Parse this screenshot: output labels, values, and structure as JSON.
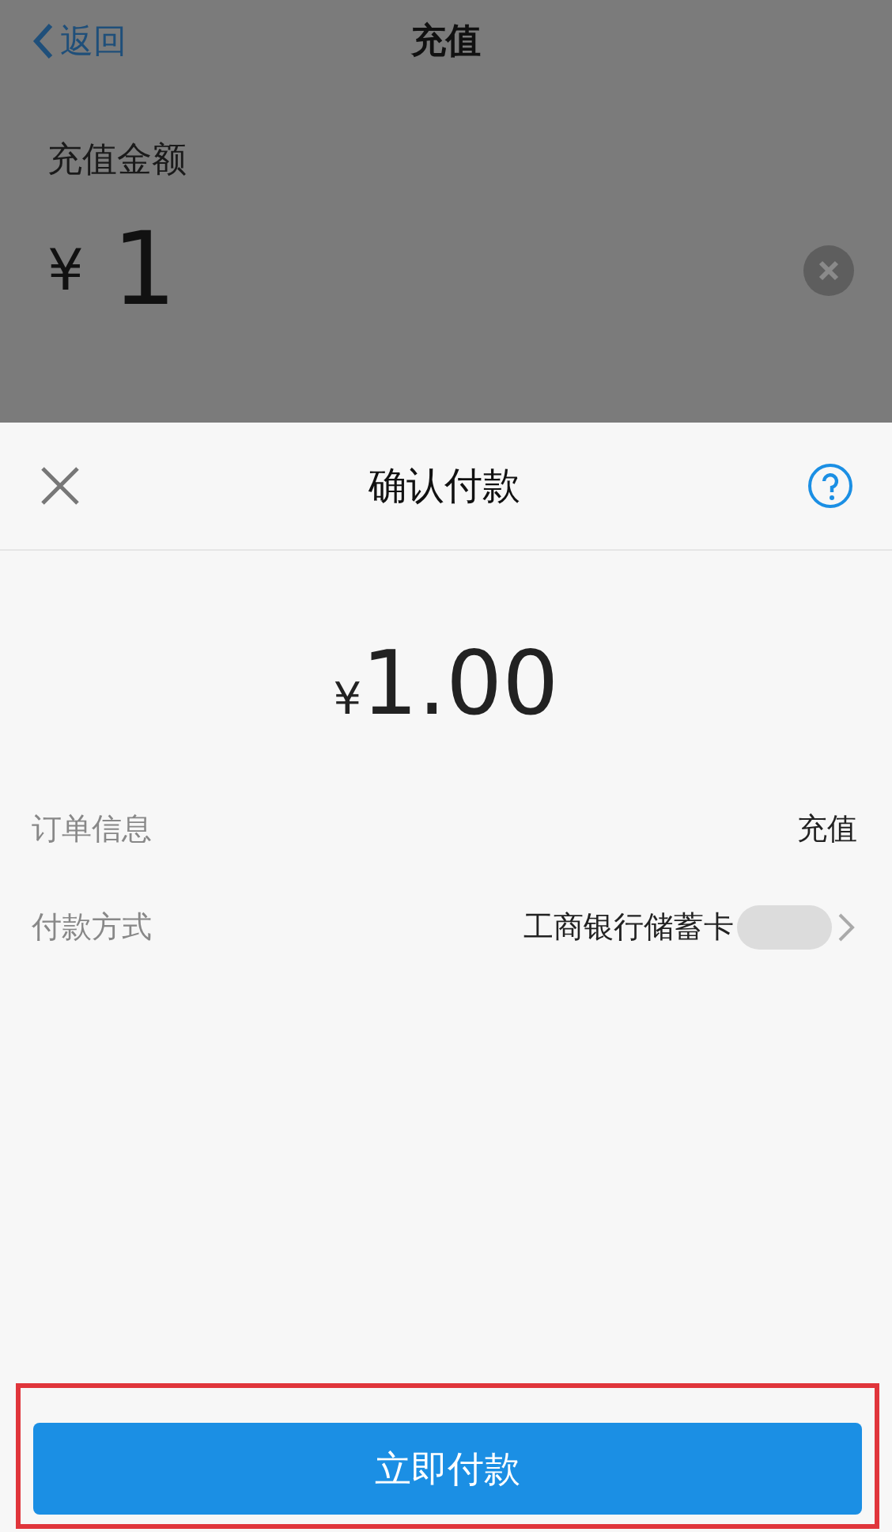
{
  "nav": {
    "back": "返回",
    "title": "充值"
  },
  "recharge": {
    "label": "充值金额",
    "currency": "¥",
    "value": "1"
  },
  "sheet": {
    "title": "确认付款",
    "amount_currency": "¥",
    "amount": "1.00",
    "rows": [
      {
        "label": "订单信息",
        "value": "充值",
        "chevron": false,
        "redacted": false
      },
      {
        "label": "付款方式",
        "value": "工商银行储蓄卡",
        "chevron": true,
        "redacted": true
      }
    ],
    "button": "立即付款",
    "highlighted": true
  }
}
